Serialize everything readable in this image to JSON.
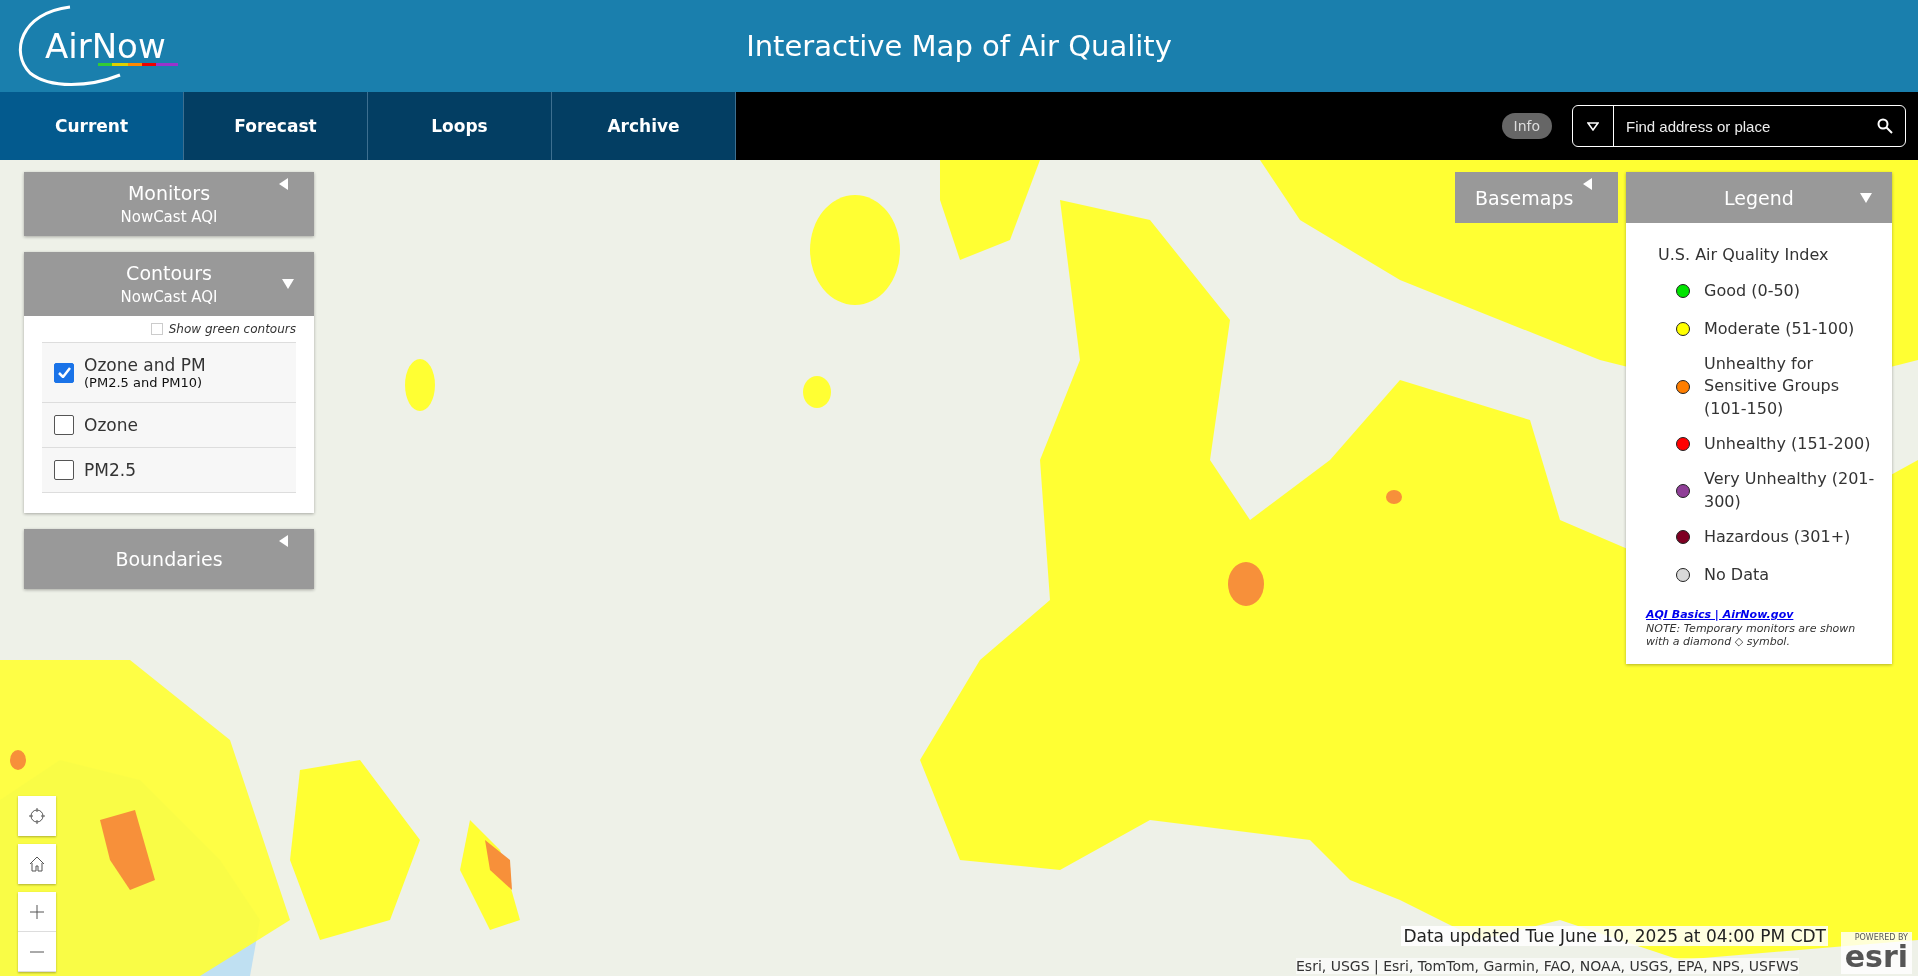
{
  "header": {
    "logo": "AirNow",
    "title": "Interactive Map of Air Quality"
  },
  "tabs": [
    {
      "label": "Current",
      "selected": true
    },
    {
      "label": "Forecast",
      "selected": false
    },
    {
      "label": "Loops",
      "selected": false
    },
    {
      "label": "Archive",
      "selected": false
    }
  ],
  "info_button": "Info",
  "search": {
    "placeholder": "Find address or place"
  },
  "panels": [
    {
      "title": "Monitors",
      "subtitle": "NowCast AQI",
      "expanded": false
    },
    {
      "title": "Contours",
      "subtitle": "NowCast AQI",
      "expanded": true,
      "show_green": {
        "label": "Show green contours",
        "checked": false
      },
      "options": [
        {
          "label": "Ozone and PM",
          "sublabel": "(PM2.5 and PM10)",
          "checked": true
        },
        {
          "label": "Ozone",
          "checked": false
        },
        {
          "label": "PM2.5",
          "checked": false
        }
      ]
    },
    {
      "title": "Boundaries",
      "expanded": false
    }
  ],
  "basemaps": {
    "title": "Basemaps",
    "expanded": false
  },
  "legend": {
    "title": "Legend",
    "expanded": true,
    "heading": "U.S. Air Quality Index",
    "items": [
      {
        "label": "Good (0-50)",
        "color": "#00e400"
      },
      {
        "label": "Moderate (51-100)",
        "color": "#ffff00"
      },
      {
        "label": "Unhealthy for Sensitive Groups (101-150)",
        "color": "#ff7e00"
      },
      {
        "label": "Unhealthy (151-200)",
        "color": "#ff0000"
      },
      {
        "label": "Very Unhealthy (201-300)",
        "color": "#8f3f97"
      },
      {
        "label": "Hazardous (301+)",
        "color": "#7e0023"
      },
      {
        "label": "No Data",
        "color": "#d9d9d9"
      }
    ],
    "link": "AQI Basics | AirNow.gov",
    "note": "NOTE: Temporary monitors are shown with a diamond ◇ symbol."
  },
  "data_updated": "Data updated Tue June 10, 2025 at 04:00 PM CDT",
  "attribution": "Esri, USGS | Esri, TomTom, Garmin, FAO, NOAA, USGS, EPA, NPS, USFWS",
  "powered_by": {
    "caption": "POWERED BY",
    "brand": "esri"
  }
}
